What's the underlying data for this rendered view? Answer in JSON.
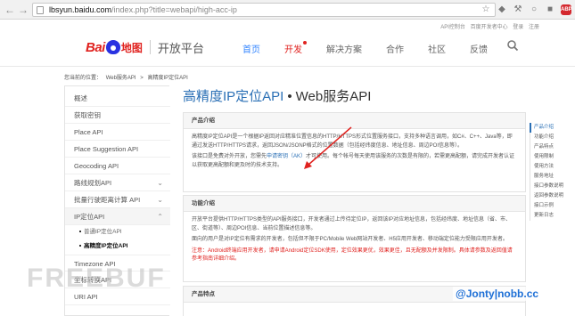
{
  "browser": {
    "url_host": "lbsyun.baidu.com",
    "url_path": "/index.php?title=webapi/high-acc-ip"
  },
  "utility_bar": [
    "API控制台",
    "百度开发者中心",
    "登录",
    "注册"
  ],
  "header": {
    "logo_bai": "Bai",
    "logo_ditu": "地图",
    "logo_platform": "开放平台",
    "nav": [
      "首页",
      "开发",
      "解决方案",
      "合作",
      "社区",
      "反馈"
    ]
  },
  "breadcrumb": [
    "您当前的位置：",
    "Web服务API",
    ">",
    "高精度IP定位API"
  ],
  "sidebar": {
    "items": [
      "概述",
      "获取密钥",
      "Place API",
      "Place Suggestion API",
      "Geocoding API",
      "路线规划API",
      "批量行驶距离计算 API",
      "IP定位API"
    ],
    "sub_items": [
      "普通IP定位API",
      "高精度IP定位API"
    ],
    "items_after": [
      "Timezone API",
      "坐标转换API",
      "URI API"
    ]
  },
  "main": {
    "title_blue": "高精度IP定位API",
    "title_dot": "•",
    "title_black": "Web服务API",
    "sections": [
      {
        "heading": "产品介绍",
        "p1": "高精度IP定位API是一个根据IP返回对应精准位置信息的HTTP/HTTPS形式位置服务接口，支持多种语言调用，如C#、C++、Java等，即通过发送HTTP/HTTPS请求，返回JSON/JSONP格式的位置数据（包括经纬度信息、地址信息、周边POI信息等）。",
        "p2_a": "该接口是免费对外开放，您需先",
        "p2_link": "申请密钥（AK）",
        "p2_b": "才可使用。每个帐号每天使用该服务的次数是有限的，若需更高配额，请完成开发者认证以获取更高配额和更及时的技术支持。"
      },
      {
        "heading": "功能介绍",
        "p1": "开放平台提供HTTP/HTTPS类型的API服务接口，开发者通过上传待定位IP，返回该IP对应地址信息，包括经纬度、地址信息（省、市、区、街道等）、周边POI信息、当前位置描述信息等。",
        "p2": "面向的用户是对IP定位有需求的开发者，包括但不限于PC/Mobile Web网站开发者、H5应用开发者、移动端定位能力受限应用开发者。",
        "p3_red": "注意：Android终端应用开发者，请申请Android定位SDK使用，定位效果更优，效果更佳，且无配额及并发限制。具体请参数及返回值请参考指南详细介绍。"
      },
      {
        "heading": "产品特点"
      }
    ]
  },
  "toc": [
    "产品介绍",
    "功能介绍",
    "产品特点",
    "使用限制",
    "使用方法",
    "服务地址",
    "接口参数说明",
    "返回参数说明",
    "接口示例",
    "更新日志"
  ],
  "watermarks": {
    "left": "FREEBUF",
    "right": "@Jonty|nobb.cc"
  },
  "colors": {
    "accent": "#2a6fb5",
    "brand_red": "#e0221f",
    "brand_blue": "#2932e1",
    "nav_active": "#3385ff"
  }
}
